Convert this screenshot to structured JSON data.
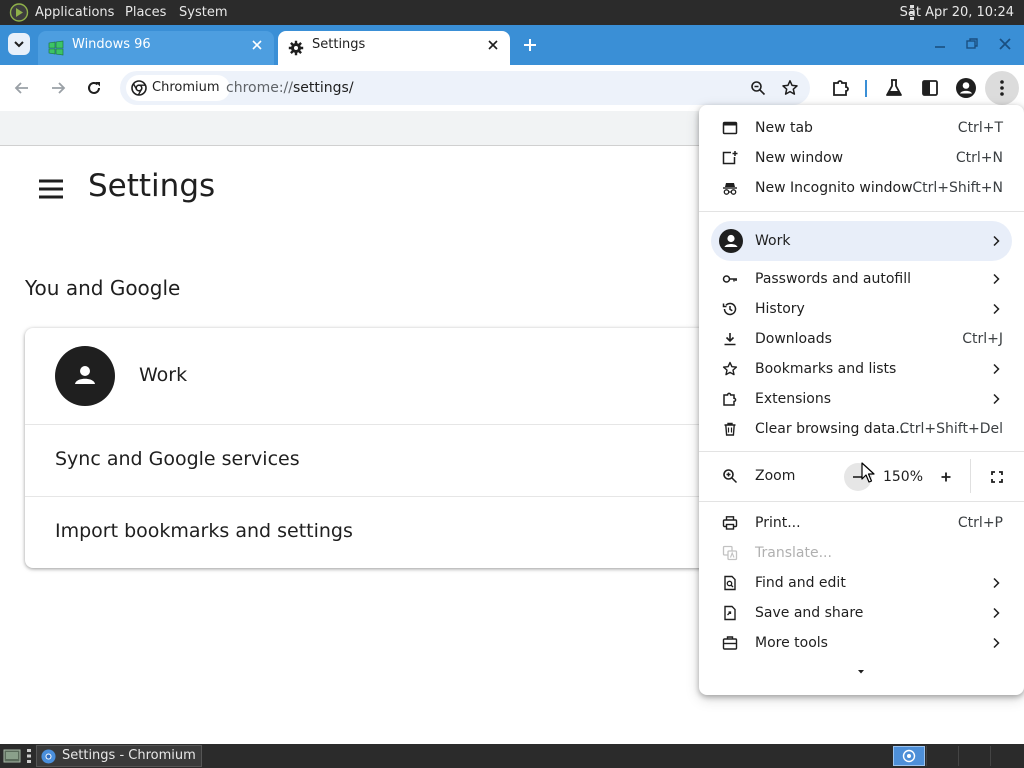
{
  "system_panel": {
    "menus": [
      "Applications",
      "Places",
      "System"
    ],
    "clock": "Sat Apr 20, 10:24"
  },
  "tabs": [
    {
      "title": "Windows 96",
      "active": false
    },
    {
      "title": "Settings",
      "active": true
    }
  ],
  "toolbar": {
    "chip_label": "Chromium",
    "url_scheme": "chrome://",
    "url_rest": "settings/"
  },
  "page": {
    "title": "Settings",
    "section_title": "You and Google",
    "profile_name": "Work",
    "rows": [
      "Sync and Google services",
      "Import bookmarks and settings"
    ]
  },
  "app_menu": {
    "group1": [
      {
        "label": "New tab",
        "shortcut": "Ctrl+T",
        "icon": "new-tab-icon"
      },
      {
        "label": "New window",
        "shortcut": "Ctrl+N",
        "icon": "new-window-icon"
      },
      {
        "label": "New Incognito window",
        "shortcut": "Ctrl+Shift+N",
        "icon": "incognito-icon"
      }
    ],
    "profile": {
      "label": "Work",
      "icon": "profile-avatar-icon"
    },
    "group2": [
      {
        "label": "Passwords and autofill",
        "icon": "key-icon",
        "submenu": true
      },
      {
        "label": "History",
        "icon": "history-icon",
        "submenu": true
      },
      {
        "label": "Downloads",
        "shortcut": "Ctrl+J",
        "icon": "download-icon"
      },
      {
        "label": "Bookmarks and lists",
        "icon": "star-icon",
        "submenu": true
      },
      {
        "label": "Extensions",
        "icon": "puzzle-icon",
        "submenu": true
      },
      {
        "label": "Clear browsing data...",
        "shortcut": "Ctrl+Shift+Del",
        "icon": "trash-icon"
      }
    ],
    "zoom": {
      "label": "Zoom",
      "value": "150%",
      "minus": "−",
      "plus": "+"
    },
    "group3": [
      {
        "label": "Print...",
        "shortcut": "Ctrl+P",
        "icon": "print-icon"
      },
      {
        "label": "Translate...",
        "icon": "translate-icon",
        "disabled": true
      },
      {
        "label": "Find and edit",
        "icon": "find-icon",
        "submenu": true
      },
      {
        "label": "Save and share",
        "icon": "save-share-icon",
        "submenu": true
      },
      {
        "label": "More tools",
        "icon": "toolbox-icon",
        "submenu": true
      }
    ]
  },
  "taskbar": {
    "window_label": "Settings - Chromium"
  },
  "colors": {
    "tabstrip": "#3a8fd6",
    "panel": "#2b2b2b",
    "menu_highlight": "#e8eef9"
  }
}
